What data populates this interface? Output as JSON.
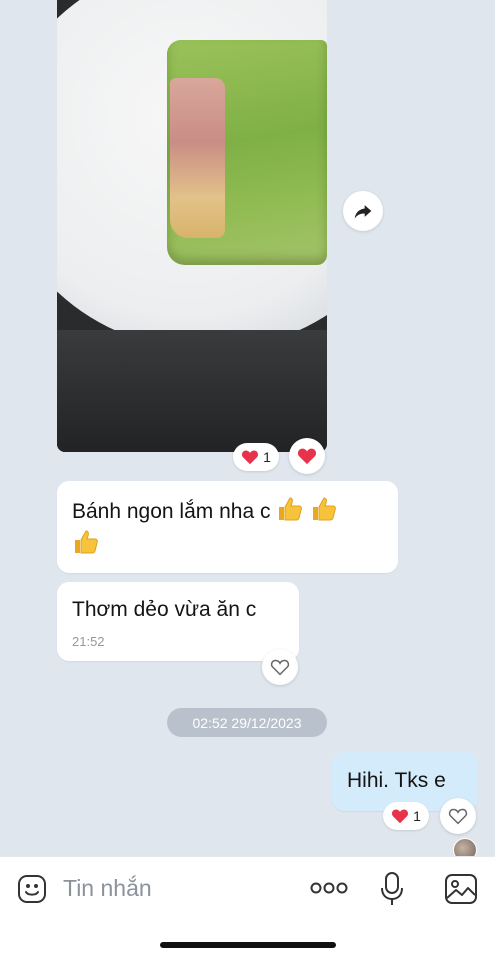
{
  "conversation": {
    "image_message": {
      "reaction": {
        "emoji": "heart",
        "count": "1"
      }
    },
    "messages_in": [
      {
        "text": "Bánh ngon lắm nha c",
        "emoji_suffix": "thumbs-up x3"
      },
      {
        "text": "Thơm dẻo vừa ăn c",
        "time": "21:52"
      }
    ],
    "date_separator": "02:52 29/12/2023",
    "message_out": {
      "text": "Hihi. Tks e",
      "reaction": {
        "emoji": "heart",
        "count": "1"
      }
    }
  },
  "composer": {
    "placeholder": "Tin nhắn",
    "icons": [
      "sticker-icon",
      "more-icon",
      "microphone-icon",
      "image-icon"
    ]
  },
  "colors": {
    "background": "#dfe6ee",
    "outgoing_bubble": "#d4ebfb",
    "incoming_bubble": "#ffffff",
    "heart": "#e8314a",
    "date_pill": "#b9c2cc"
  }
}
